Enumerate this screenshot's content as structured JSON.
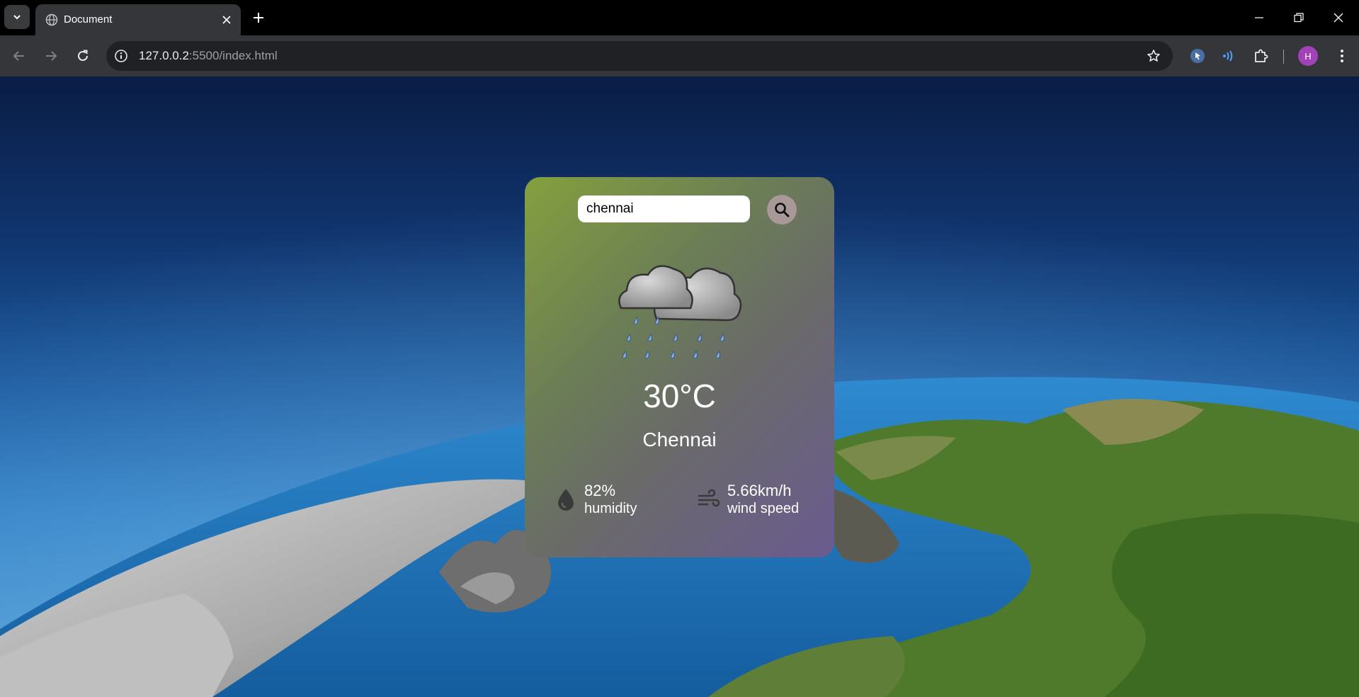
{
  "browser": {
    "tab_title": "Document",
    "url_host": "127.0.0.2",
    "url_rest": ":5500/index.html",
    "profile_initial": "H"
  },
  "weather": {
    "search_value": "chennai",
    "temperature": "30°C",
    "city": "Chennai",
    "humidity_value": "82%",
    "humidity_label": "humidity",
    "wind_value": "5.66km/h",
    "wind_label": "wind speed",
    "condition_icon": "rain-cloud-icon"
  },
  "colors": {
    "card_gradient_start": "#84a03e",
    "card_gradient_end": "#6a5b90",
    "search_button": "#a89898"
  }
}
